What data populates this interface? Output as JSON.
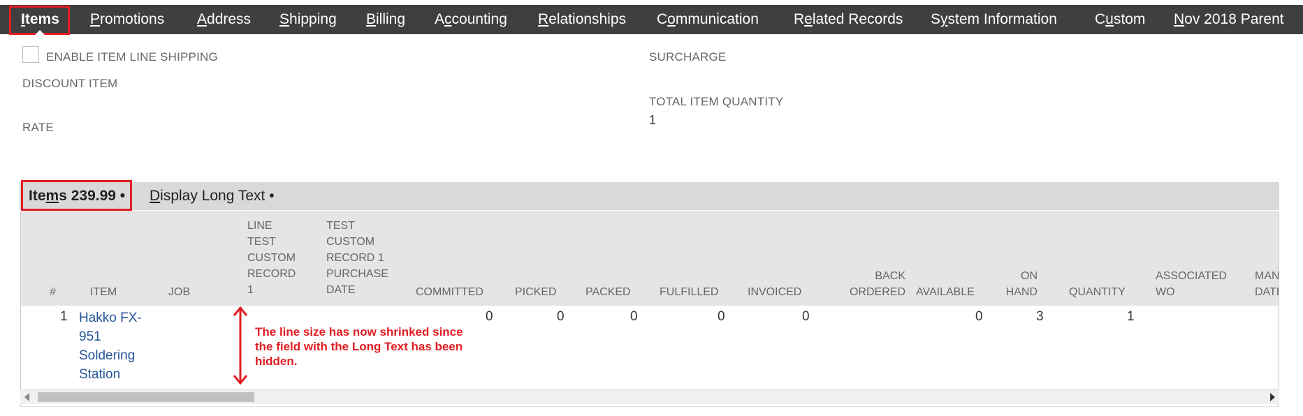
{
  "nav": {
    "items": [
      {
        "pre": "",
        "accel": "I",
        "post": "tems"
      },
      {
        "pre": "",
        "accel": "P",
        "post": "romotions"
      },
      {
        "pre": "",
        "accel": "A",
        "post": "ddress"
      },
      {
        "pre": "",
        "accel": "S",
        "post": "hipping"
      },
      {
        "pre": "",
        "accel": "B",
        "post": "illing"
      },
      {
        "pre": "A",
        "accel": "c",
        "post": "counting"
      },
      {
        "pre": "",
        "accel": "R",
        "post": "elationships"
      },
      {
        "pre": "C",
        "accel": "o",
        "post": "mmunication"
      },
      {
        "pre": "R",
        "accel": "e",
        "post": "lated Records"
      },
      {
        "pre": "S",
        "accel": "y",
        "post": "stem Information"
      },
      {
        "pre": "C",
        "accel": "u",
        "post": "stom"
      },
      {
        "pre": "",
        "accel": "N",
        "post": "ov 2018 Parent"
      }
    ]
  },
  "form": {
    "enable_item_line_shipping": "ENABLE ITEM LINE SHIPPING",
    "discount_item": "DISCOUNT ITEM",
    "rate": "RATE",
    "surcharge": "SURCHARGE",
    "total_item_quantity_label": "TOTAL ITEM QUANTITY",
    "total_item_quantity_value": "1"
  },
  "subtabs": {
    "items": {
      "pre": "Ite",
      "accel": "m",
      "post": "s 239.99 •"
    },
    "display_long_text": {
      "pre": "",
      "accel": "D",
      "post": "isplay Long Text •"
    }
  },
  "grid": {
    "headers": {
      "num": "#",
      "item": "ITEM",
      "job": "JOB",
      "line_test": "LINE\nTEST\nCUSTOM\nRECORD\n1",
      "test_custom": "TEST\nCUSTOM\nRECORD 1\nPURCHASE\nDATE",
      "committed": "COMMITTED",
      "picked": "PICKED",
      "packed": "PACKED",
      "fulfilled": "FULFILLED",
      "invoiced": "INVOICED",
      "back_ordered": "BACK\nORDERED",
      "available": "AVAILABLE",
      "on_hand": "ON\nHAND",
      "quantity": "QUANTITY",
      "associated_wo": "ASSOCIATED\nWO",
      "man_date": "MAN\nDATE"
    },
    "row": {
      "num": "1",
      "item": "Hakko FX-\n951\nSoldering\nStation",
      "committed": "0",
      "picked": "0",
      "packed": "0",
      "fulfilled": "0",
      "invoiced": "0",
      "available": "0",
      "on_hand": "3",
      "quantity": "1"
    }
  },
  "annotation": {
    "text": "The line size has now shrinked since the field with the Long Text has been hidden."
  },
  "colors": {
    "nav_bg": "#3f3f3f",
    "highlight_red": "#e01d23",
    "link_blue": "#255599"
  }
}
